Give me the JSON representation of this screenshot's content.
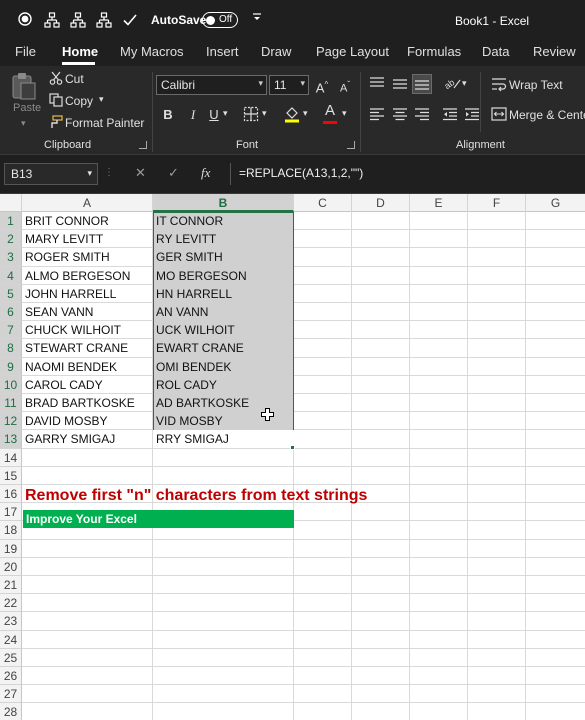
{
  "title_bar": {
    "autosave_label": "AutoSave",
    "autosave_state": "Off",
    "document_title": "Book1 - Excel"
  },
  "tabs": [
    "File",
    "Home",
    "My Macros",
    "Insert",
    "Draw",
    "Page Layout",
    "Formulas",
    "Data",
    "Review"
  ],
  "active_tab": "Home",
  "ribbon": {
    "clipboard": {
      "paste": "Paste",
      "cut": "Cut",
      "copy": "Copy",
      "format_painter": "Format Painter",
      "label": "Clipboard"
    },
    "font": {
      "font_name": "Calibri",
      "font_size": "11",
      "bold": "B",
      "italic": "I",
      "underline": "U",
      "font_color_glyph": "A",
      "label": "Font"
    },
    "alignment": {
      "wrap_text": "Wrap Text",
      "merge_center": "Merge & Center",
      "label": "Alignment"
    }
  },
  "formula_bar": {
    "name_box": "B13",
    "fx": "fx",
    "formula": "=REPLACE(A13,1,2,\"\")"
  },
  "grid": {
    "columns": [
      "A",
      "B",
      "C",
      "D",
      "E",
      "F",
      "G"
    ],
    "selected_column": "B",
    "rows": [
      "1",
      "2",
      "3",
      "4",
      "5",
      "6",
      "7",
      "8",
      "9",
      "10",
      "11",
      "12",
      "13",
      "14",
      "15",
      "16",
      "17",
      "18",
      "19",
      "20",
      "21",
      "22",
      "23",
      "24",
      "25",
      "26",
      "27",
      "28"
    ],
    "col_a": [
      "BRIT CONNOR",
      "MARY LEVITT",
      "ROGER SMITH",
      "ALMO BERGESON",
      "JOHN HARRELL",
      "SEAN VANN",
      "CHUCK WILHOIT",
      "STEWART CRANE",
      "NAOMI BENDEK",
      "CAROL CADY",
      "BRAD BARTKOSKE",
      "DAVID MOSBY",
      "GARRY SMIGAJ"
    ],
    "col_b": [
      "IT CONNOR",
      "RY LEVITT",
      "GER SMITH",
      "MO BERGESON",
      "HN HARRELL",
      "AN VANN",
      "UCK WILHOIT",
      "EWART CRANE",
      "OMI BENDEK",
      "ROL CADY",
      "AD BARTKOSKE",
      "VID MOSBY",
      "RRY SMIGAJ"
    ],
    "headline": "Remove first \"n\" characters from text strings",
    "banner": "Improve Your Excel"
  },
  "colors": {
    "excel_green": "#217346",
    "headline_red": "#c00000",
    "banner_green": "#00b050",
    "selection_gray": "#d0d0d0"
  }
}
